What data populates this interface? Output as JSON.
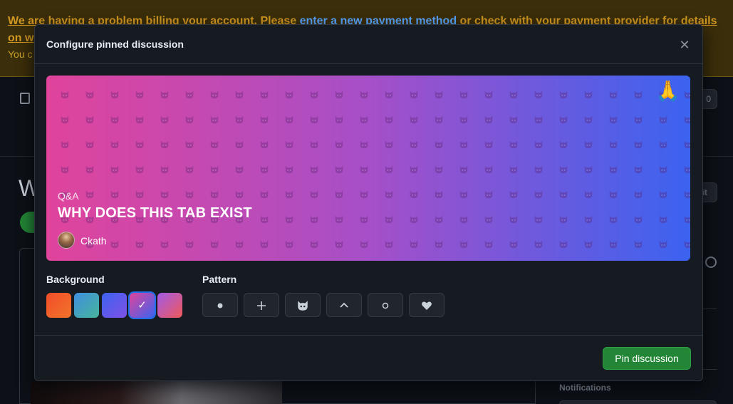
{
  "banner": {
    "text_before_link": "We are having a problem billing your account. Please ",
    "link": "enter a new payment method",
    "text_after_link": " or check with your payment provider for details",
    "text_line2": "on w",
    "sub_text": "You c"
  },
  "background_page": {
    "title_fragment": "W",
    "pill_fragment": "0",
    "edit_fragment": "lit",
    "notifications_label": "Notifications"
  },
  "modal": {
    "title": "Configure pinned discussion",
    "close_icon": "close-icon",
    "preview": {
      "emoji": "🙏",
      "category": "Q&A",
      "title": "WHY DOES THIS TAB EXIST",
      "author": "Ckath",
      "pattern_icon": "octocat-icon",
      "gradient": [
        "#e0449c",
        "#a64fc8",
        "#3b63f0"
      ]
    },
    "background_label": "Background",
    "backgrounds": [
      {
        "name": "orange-red",
        "colors": [
          "#f04d2a",
          "#f2742a"
        ],
        "selected": false
      },
      {
        "name": "blue-green",
        "colors": [
          "#3f8fe0",
          "#48b59a"
        ],
        "selected": false
      },
      {
        "name": "blue-purple",
        "colors": [
          "#3c62f0",
          "#7f52e6"
        ],
        "selected": false
      },
      {
        "name": "pink-blue",
        "colors": [
          "#e0449c",
          "#3b63f0"
        ],
        "selected": true
      },
      {
        "name": "purple-red",
        "colors": [
          "#a15ae8",
          "#f05a5a"
        ],
        "selected": false
      }
    ],
    "selected_check": "✓",
    "pattern_label": "Pattern",
    "patterns": [
      {
        "name": "dot",
        "icon": "dot-icon"
      },
      {
        "name": "plus",
        "icon": "plus-icon"
      },
      {
        "name": "octocat",
        "icon": "octocat-icon"
      },
      {
        "name": "chevron",
        "icon": "chevron-up-icon"
      },
      {
        "name": "circle",
        "icon": "circle-icon"
      },
      {
        "name": "heart",
        "icon": "heart-icon"
      }
    ],
    "submit_label": "Pin discussion"
  }
}
